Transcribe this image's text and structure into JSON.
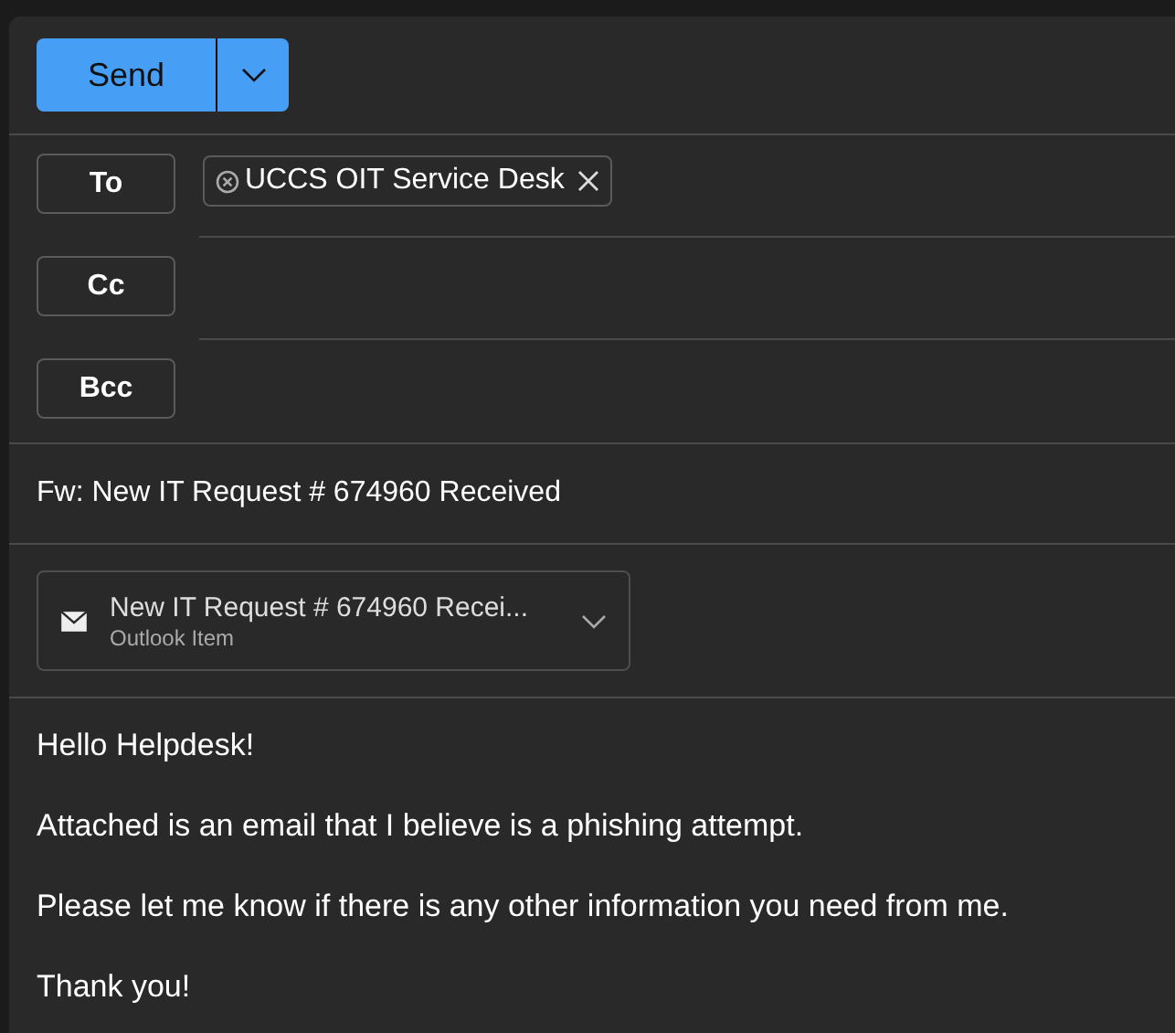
{
  "toolbar": {
    "send_label": "Send"
  },
  "recipients": [
    {
      "label": "To",
      "chips": [
        "UCCS OIT Service Desk"
      ]
    },
    {
      "label": "Cc"
    },
    {
      "label": "Bcc"
    }
  ],
  "subject": "Fw: New IT Request # 674960 Received",
  "attachment": {
    "title": "New IT Request # 674960 Recei...",
    "subtitle": "Outlook Item"
  },
  "body": [
    "Hello Helpdesk!",
    "Attached is an email that I believe is a phishing attempt.",
    "Please let me know if there is any other information you need from me.",
    "Thank you!"
  ]
}
